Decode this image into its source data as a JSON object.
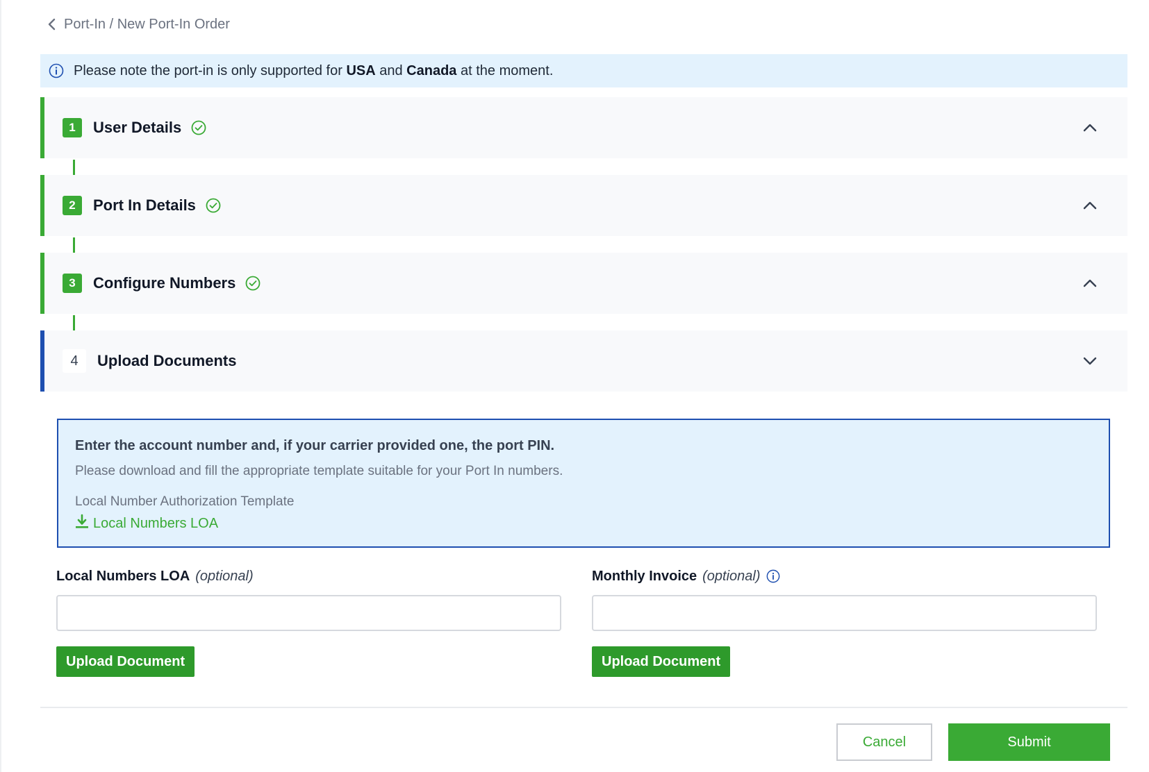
{
  "breadcrumb": {
    "text": "Port-In / New Port-In Order",
    "back_icon": "chevron-left-icon"
  },
  "notice": {
    "icon": "info-icon",
    "prefix": "Please note the port-in is only supported for ",
    "country1": "USA",
    "middle": " and ",
    "country2": "Canada",
    "suffix": " at the moment."
  },
  "steps": [
    {
      "number": "1",
      "title": "User Details",
      "completed": true,
      "chevron": "chevron-up-icon"
    },
    {
      "number": "2",
      "title": "Port In Details",
      "completed": true,
      "chevron": "chevron-up-icon"
    },
    {
      "number": "3",
      "title": "Configure Numbers",
      "completed": true,
      "chevron": "chevron-up-icon"
    },
    {
      "number": "4",
      "title": "Upload Documents",
      "completed": false,
      "chevron": "chevron-down-icon"
    }
  ],
  "instructions": {
    "heading": "Enter the account number and, if your carrier provided one, the port PIN.",
    "text": "Please download and fill the appropriate template suitable for your Port In numbers.",
    "template_label": "Local Number Authorization Template",
    "download_link": "Local Numbers LOA",
    "download_icon": "download-icon"
  },
  "fields": {
    "loa": {
      "label": "Local Numbers LOA",
      "optional": "(optional)",
      "value": "",
      "button": "Upload Document"
    },
    "invoice": {
      "label": "Monthly Invoice",
      "optional": "(optional)",
      "value": "",
      "button": "Upload Document",
      "info_icon": "info-icon"
    }
  },
  "actions": {
    "cancel": "Cancel",
    "submit": "Submit"
  },
  "colors": {
    "accent_green": "#3aaa35",
    "active_blue": "#1e4fb0",
    "notice_bg": "#e3f2fd"
  }
}
